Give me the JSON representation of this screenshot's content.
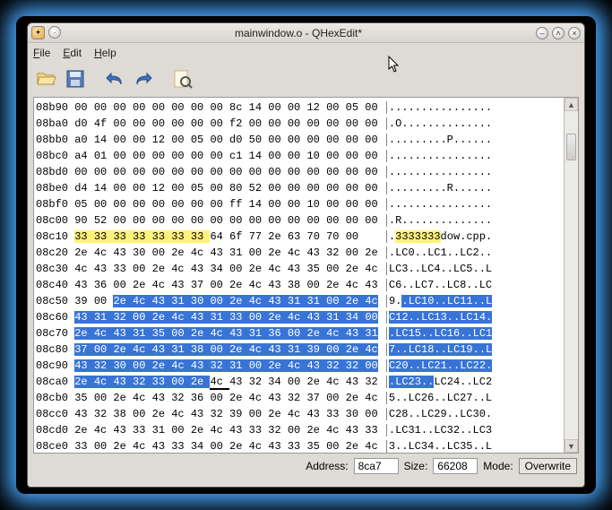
{
  "title": "mainwindow.o - QHexEdit*",
  "menu": {
    "file": "File",
    "edit": "Edit",
    "help": "Help"
  },
  "toolbar": {
    "open": "open",
    "save": "save",
    "undo": "undo",
    "redo": "redo",
    "find": "find"
  },
  "status": {
    "address_label": "Address:",
    "address_value": "8ca7",
    "size_label": "Size:",
    "size_value": "66208",
    "mode_label": "Mode:",
    "mode_value": "Overwrite"
  },
  "hex": {
    "rows": [
      {
        "addr": "08b90",
        "bytes": [
          "00",
          "00",
          "00",
          "00",
          "00",
          "00",
          "00",
          "00",
          "8c",
          "14",
          "00",
          "00",
          "12",
          "00",
          "05",
          "00"
        ],
        "ascii": "................"
      },
      {
        "addr": "08ba0",
        "bytes": [
          "d0",
          "4f",
          "00",
          "00",
          "00",
          "00",
          "00",
          "00",
          "f2",
          "00",
          "00",
          "00",
          "00",
          "00",
          "00",
          "00"
        ],
        "ascii": ".O.............."
      },
      {
        "addr": "08bb0",
        "bytes": [
          "a0",
          "14",
          "00",
          "00",
          "12",
          "00",
          "05",
          "00",
          "d0",
          "50",
          "00",
          "00",
          "00",
          "00",
          "00",
          "00"
        ],
        "ascii": ".........P......"
      },
      {
        "addr": "08bc0",
        "bytes": [
          "a4",
          "01",
          "00",
          "00",
          "00",
          "00",
          "00",
          "00",
          "c1",
          "14",
          "00",
          "00",
          "10",
          "00",
          "00",
          "00"
        ],
        "ascii": "................"
      },
      {
        "addr": "08bd0",
        "bytes": [
          "00",
          "00",
          "00",
          "00",
          "00",
          "00",
          "00",
          "00",
          "00",
          "00",
          "00",
          "00",
          "00",
          "00",
          "00",
          "00"
        ],
        "ascii": "................"
      },
      {
        "addr": "08be0",
        "bytes": [
          "d4",
          "14",
          "00",
          "00",
          "12",
          "00",
          "05",
          "00",
          "80",
          "52",
          "00",
          "00",
          "00",
          "00",
          "00",
          "00"
        ],
        "ascii": ".........R......"
      },
      {
        "addr": "08bf0",
        "bytes": [
          "05",
          "00",
          "00",
          "00",
          "00",
          "00",
          "00",
          "00",
          "ff",
          "14",
          "00",
          "00",
          "10",
          "00",
          "00",
          "00"
        ],
        "ascii": "................"
      },
      {
        "addr": "08c00",
        "bytes": [
          "90",
          "52",
          "00",
          "00",
          "00",
          "00",
          "00",
          "00",
          "00",
          "00",
          "00",
          "00",
          "00",
          "00",
          "00",
          "00"
        ],
        "ascii": ".R.............."
      },
      {
        "addr": "08c10",
        "bytes": [
          "33",
          "33",
          "33",
          "33",
          "33",
          "33",
          "33",
          "64",
          "6f",
          "77",
          "2e",
          "63",
          "70",
          "70",
          "00"
        ],
        "ascii": ".3333333dow.cpp.",
        "hl": {
          "hex": [
            0,
            7,
            "yellow"
          ],
          "ascii": [
            1,
            8,
            "yellow"
          ]
        }
      },
      {
        "addr": "08c20",
        "bytes": [
          "2e",
          "4c",
          "43",
          "30",
          "00",
          "2e",
          "4c",
          "43",
          "31",
          "00",
          "2e",
          "4c",
          "43",
          "32",
          "00",
          "2e"
        ],
        "ascii": ".LC0..LC1..LC2.."
      },
      {
        "addr": "08c30",
        "bytes": [
          "4c",
          "43",
          "33",
          "00",
          "2e",
          "4c",
          "43",
          "34",
          "00",
          "2e",
          "4c",
          "43",
          "35",
          "00",
          "2e",
          "4c"
        ],
        "ascii": "LC3..LC4..LC5..L"
      },
      {
        "addr": "08c40",
        "bytes": [
          "43",
          "36",
          "00",
          "2e",
          "4c",
          "43",
          "37",
          "00",
          "2e",
          "4c",
          "43",
          "38",
          "00",
          "2e",
          "4c",
          "43"
        ],
        "ascii": "C6..LC7..LC8..LC"
      },
      {
        "addr": "08c50",
        "bytes": [
          "39",
          "00",
          "2e",
          "4c",
          "43",
          "31",
          "30",
          "00",
          "2e",
          "4c",
          "43",
          "31",
          "31",
          "00",
          "2e",
          "4c"
        ],
        "ascii": "9..LC10..LC11..L",
        "hl": {
          "hex": [
            2,
            16,
            "blue"
          ],
          "ascii": [
            2,
            16,
            "blue"
          ]
        }
      },
      {
        "addr": "08c60",
        "bytes": [
          "43",
          "31",
          "32",
          "00",
          "2e",
          "4c",
          "43",
          "31",
          "33",
          "00",
          "2e",
          "4c",
          "43",
          "31",
          "34",
          "00"
        ],
        "ascii": "C12..LC13..LC14.",
        "hl": {
          "hex": [
            0,
            16,
            "blue"
          ],
          "ascii": [
            0,
            16,
            "blue"
          ]
        }
      },
      {
        "addr": "08c70",
        "bytes": [
          "2e",
          "4c",
          "43",
          "31",
          "35",
          "00",
          "2e",
          "4c",
          "43",
          "31",
          "36",
          "00",
          "2e",
          "4c",
          "43",
          "31"
        ],
        "ascii": ".LC15..LC16..LC1",
        "hl": {
          "hex": [
            0,
            16,
            "blue"
          ],
          "ascii": [
            0,
            16,
            "blue"
          ]
        }
      },
      {
        "addr": "08c80",
        "bytes": [
          "37",
          "00",
          "2e",
          "4c",
          "43",
          "31",
          "38",
          "00",
          "2e",
          "4c",
          "43",
          "31",
          "39",
          "00",
          "2e",
          "4c"
        ],
        "ascii": "7..LC18..LC19..L",
        "hl": {
          "hex": [
            0,
            16,
            "blue"
          ],
          "ascii": [
            0,
            16,
            "blue"
          ]
        }
      },
      {
        "addr": "08c90",
        "bytes": [
          "43",
          "32",
          "30",
          "00",
          "2e",
          "4c",
          "43",
          "32",
          "31",
          "00",
          "2e",
          "4c",
          "43",
          "32",
          "32",
          "00"
        ],
        "ascii": "C20..LC21..LC22.",
        "hl": {
          "hex": [
            0,
            16,
            "blue"
          ],
          "ascii": [
            0,
            16,
            "blue"
          ]
        }
      },
      {
        "addr": "08ca0",
        "bytes": [
          "2e",
          "4c",
          "43",
          "32",
          "33",
          "00",
          "2e",
          "4c",
          "43",
          "32",
          "34",
          "00",
          "2e",
          "4c",
          "43",
          "32"
        ],
        "ascii": ".LC23..LC24..LC2",
        "hl": {
          "hex": [
            0,
            7,
            "blue"
          ],
          "ascii": [
            0,
            7,
            "blue"
          ]
        },
        "cursor": 7
      },
      {
        "addr": "08cb0",
        "bytes": [
          "35",
          "00",
          "2e",
          "4c",
          "43",
          "32",
          "36",
          "00",
          "2e",
          "4c",
          "43",
          "32",
          "37",
          "00",
          "2e",
          "4c"
        ],
        "ascii": "5..LC26..LC27..L"
      },
      {
        "addr": "08cc0",
        "bytes": [
          "43",
          "32",
          "38",
          "00",
          "2e",
          "4c",
          "43",
          "32",
          "39",
          "00",
          "2e",
          "4c",
          "43",
          "33",
          "30",
          "00"
        ],
        "ascii": "C28..LC29..LC30."
      },
      {
        "addr": "08cd0",
        "bytes": [
          "2e",
          "4c",
          "43",
          "33",
          "31",
          "00",
          "2e",
          "4c",
          "43",
          "33",
          "32",
          "00",
          "2e",
          "4c",
          "43",
          "33"
        ],
        "ascii": ".LC31..LC32..LC3"
      },
      {
        "addr": "08ce0",
        "bytes": [
          "33",
          "00",
          "2e",
          "4c",
          "43",
          "33",
          "34",
          "00",
          "2e",
          "4c",
          "43",
          "33",
          "35",
          "00",
          "2e",
          "4c"
        ],
        "ascii": "3..LC34..LC35..L"
      }
    ]
  }
}
